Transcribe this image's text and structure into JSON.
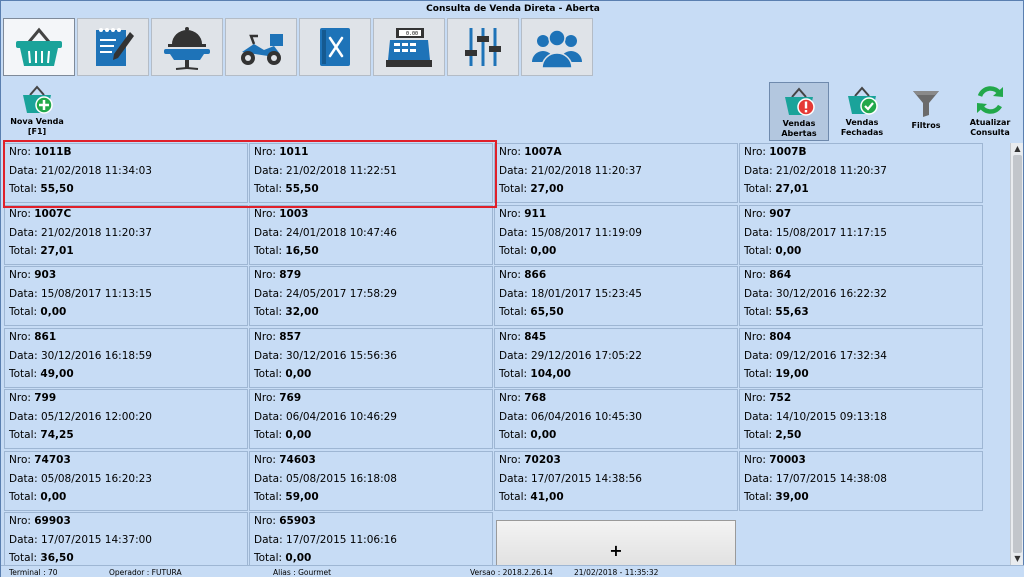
{
  "window": {
    "title": "Consulta de Venda Direta - Aberta"
  },
  "top_tabs": [
    {
      "icon": "basket-icon",
      "active": true
    },
    {
      "icon": "notepad-pencil-icon",
      "active": false
    },
    {
      "icon": "serving-cloche-table-icon",
      "active": false
    },
    {
      "icon": "delivery-scooter-icon",
      "active": false
    },
    {
      "icon": "menu-book-icon",
      "active": false
    },
    {
      "icon": "cash-register-icon",
      "active": false
    },
    {
      "icon": "sliders-icon",
      "active": false
    },
    {
      "icon": "users-icon",
      "active": false
    }
  ],
  "cash_register_display": "0.00",
  "toolbar": {
    "nova_venda": {
      "label": "Nova Venda",
      "shortcut": "[F1]"
    },
    "vendas_abertas": {
      "label1": "Vendas",
      "label2": "Abertas"
    },
    "vendas_fechadas": {
      "label1": "Vendas",
      "label2": "Fechadas"
    },
    "filtros": {
      "label": "Filtros"
    },
    "atualizar": {
      "label1": "Atualizar",
      "label2": "Consulta"
    }
  },
  "labels": {
    "nro": "Nro:",
    "data": "Data:",
    "total": "Total:"
  },
  "sales": [
    {
      "nro": "1011B",
      "data": "21/02/2018 11:34:03",
      "total": "55,50"
    },
    {
      "nro": "1011",
      "data": "21/02/2018 11:22:51",
      "total": "55,50"
    },
    {
      "nro": "1007A",
      "data": "21/02/2018 11:20:37",
      "total": "27,00"
    },
    {
      "nro": "1007B",
      "data": "21/02/2018 11:20:37",
      "total": "27,01"
    },
    {
      "nro": "1007C",
      "data": "21/02/2018 11:20:37",
      "total": "27,01"
    },
    {
      "nro": "1003",
      "data": "24/01/2018 10:47:46",
      "total": "16,50"
    },
    {
      "nro": "911",
      "data": "15/08/2017 11:19:09",
      "total": "0,00"
    },
    {
      "nro": "907",
      "data": "15/08/2017 11:17:15",
      "total": "0,00"
    },
    {
      "nro": "903",
      "data": "15/08/2017 11:13:15",
      "total": "0,00"
    },
    {
      "nro": "879",
      "data": "24/05/2017 17:58:29",
      "total": "32,00"
    },
    {
      "nro": "866",
      "data": "18/01/2017 15:23:45",
      "total": "65,50"
    },
    {
      "nro": "864",
      "data": "30/12/2016 16:22:32",
      "total": "55,63"
    },
    {
      "nro": "861",
      "data": "30/12/2016 16:18:59",
      "total": "49,00"
    },
    {
      "nro": "857",
      "data": "30/12/2016 15:56:36",
      "total": "0,00"
    },
    {
      "nro": "845",
      "data": "29/12/2016 17:05:22",
      "total": "104,00"
    },
    {
      "nro": "804",
      "data": "09/12/2016 17:32:34",
      "total": "19,00"
    },
    {
      "nro": "799",
      "data": "05/12/2016 12:00:20",
      "total": "74,25"
    },
    {
      "nro": "769",
      "data": "06/04/2016 10:46:29",
      "total": "0,00"
    },
    {
      "nro": "768",
      "data": "06/04/2016 10:45:30",
      "total": "0,00"
    },
    {
      "nro": "752",
      "data": "14/10/2015 09:13:18",
      "total": "2,50"
    },
    {
      "nro": "74703",
      "data": "05/08/2015 16:20:23",
      "total": "0,00"
    },
    {
      "nro": "74603",
      "data": "05/08/2015 16:18:08",
      "total": "59,00"
    },
    {
      "nro": "70203",
      "data": "17/07/2015 14:38:56",
      "total": "41,00"
    },
    {
      "nro": "70003",
      "data": "17/07/2015 14:38:08",
      "total": "39,00"
    },
    {
      "nro": "69903",
      "data": "17/07/2015 14:37:00",
      "total": "36,50"
    },
    {
      "nro": "65903",
      "data": "17/07/2015 11:06:16",
      "total": "0,00"
    }
  ],
  "add_button": {
    "label": "+"
  },
  "status": {
    "terminal": "Terminal : 70",
    "operador": "Operador : FUTURA",
    "alias": "Alias : Gourmet",
    "versao": "Versao : 2018.2.26.14",
    "datetime": "21/02/2018 - 11:35:32"
  },
  "colors": {
    "background": "#c7dcf5",
    "icon_teal": "#1aa39a",
    "icon_blue": "#1e73b8",
    "selection": "#e0202a",
    "alert_red": "#e53935",
    "ok_green": "#22a84a"
  }
}
